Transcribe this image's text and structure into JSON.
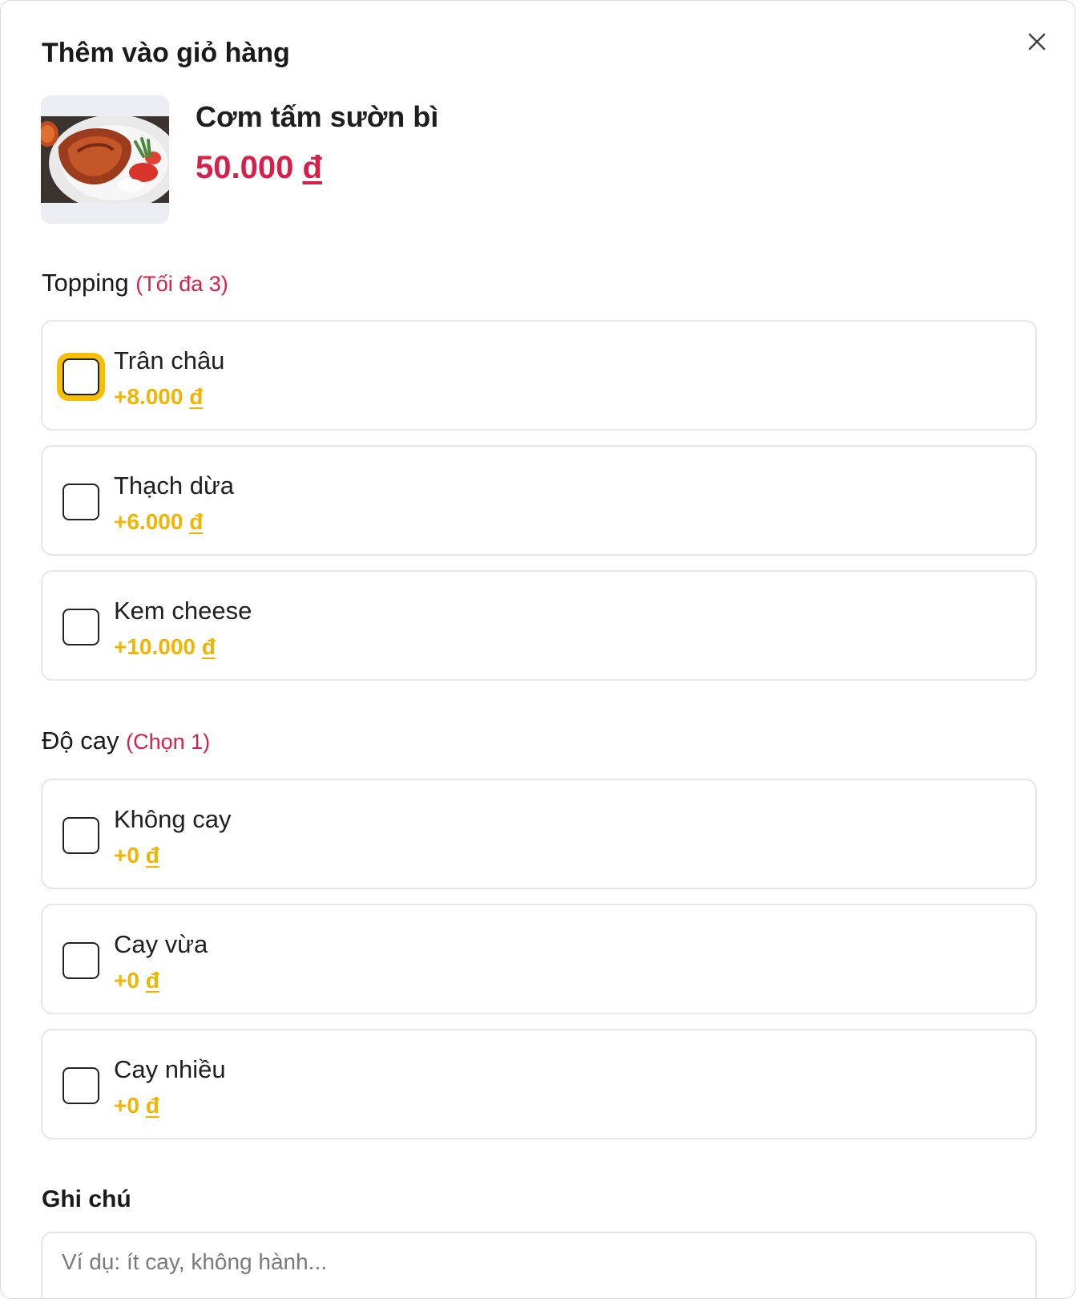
{
  "modal": {
    "title": "Thêm vào giỏ hàng"
  },
  "product": {
    "name": "Cơm tấm sườn bì",
    "price_value": "50.000",
    "price_currency": "đ",
    "image_icon": "food-photo"
  },
  "topping": {
    "title": "Topping",
    "hint": "(Tối đa 3)",
    "options": [
      {
        "label": "Trân châu",
        "price_value": "+8.000",
        "currency": "đ",
        "checked": false
      },
      {
        "label": "Thạch dừa",
        "price_value": "+6.000",
        "currency": "đ",
        "checked": false
      },
      {
        "label": "Kem cheese",
        "price_value": "+10.000",
        "currency": "đ",
        "checked": false
      }
    ]
  },
  "spice": {
    "title": "Độ cay",
    "hint": "(Chọn 1)",
    "options": [
      {
        "label": "Không cay",
        "price_value": "+0",
        "currency": "đ",
        "checked": false
      },
      {
        "label": "Cay vừa",
        "price_value": "+0",
        "currency": "đ",
        "checked": false
      },
      {
        "label": "Cay nhiều",
        "price_value": "+0",
        "currency": "đ",
        "checked": false
      }
    ]
  },
  "note": {
    "title": "Ghi chú",
    "placeholder": "Ví dụ: ít cay, không hành..."
  },
  "colors": {
    "accent_red": "#d81f4a",
    "price_yellow": "#f2b400",
    "focus_ring": "#f6c000"
  }
}
